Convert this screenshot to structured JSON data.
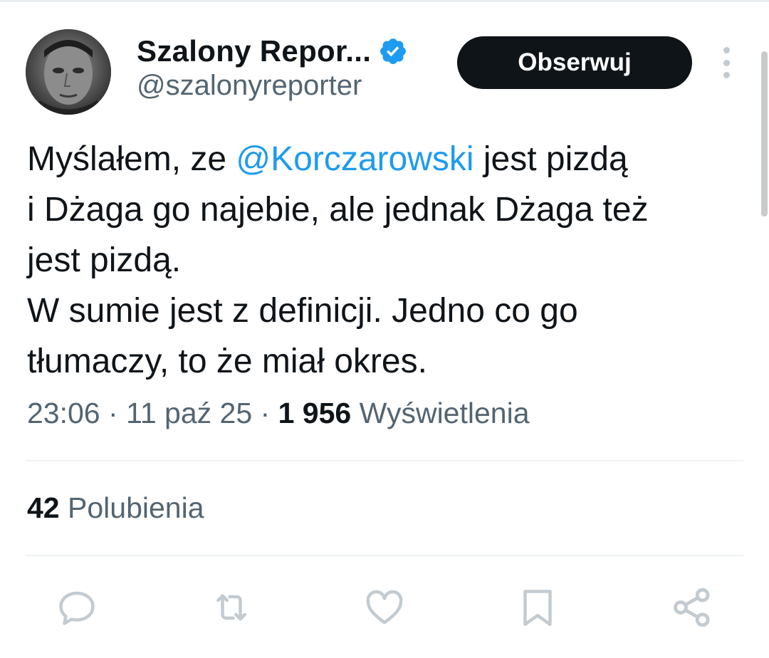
{
  "author": {
    "display_name": "Szalony Repor...",
    "handle": "@szalonyreporter",
    "verified_icon": "verified-badge-icon",
    "verified_color": "#1d9bf0"
  },
  "header": {
    "follow_label": "Obserwuj",
    "more_icon": "more-vertical-icon"
  },
  "tweet": {
    "line1_before": "Myślałem, ze ",
    "line1_mention": "@Korczarowski",
    "line1_after": " jest pizdą",
    "line2": "i Dżaga go najebie, ale jednak Dżaga też",
    "line3": "jest pizdą.",
    "line4": "W sumie jest z definicji. Jedno co go",
    "line5": "tłumaczy, to że miał okres."
  },
  "meta": {
    "time": "23:06",
    "separator": "·",
    "date": "11 paź 25",
    "views_count": "1 956",
    "views_label": "Wyświetlenia"
  },
  "stats": {
    "likes_count": "42",
    "likes_label": "Polubienia"
  },
  "actions": [
    "reply-icon",
    "retweet-icon",
    "like-icon",
    "bookmark-icon",
    "share-icon"
  ],
  "colors": {
    "text_primary": "#0f1419",
    "text_secondary": "#536471",
    "mention": "#1d9bf0",
    "follow_button_bg": "#0f1419",
    "icon_gray": "#c3cbd1"
  }
}
